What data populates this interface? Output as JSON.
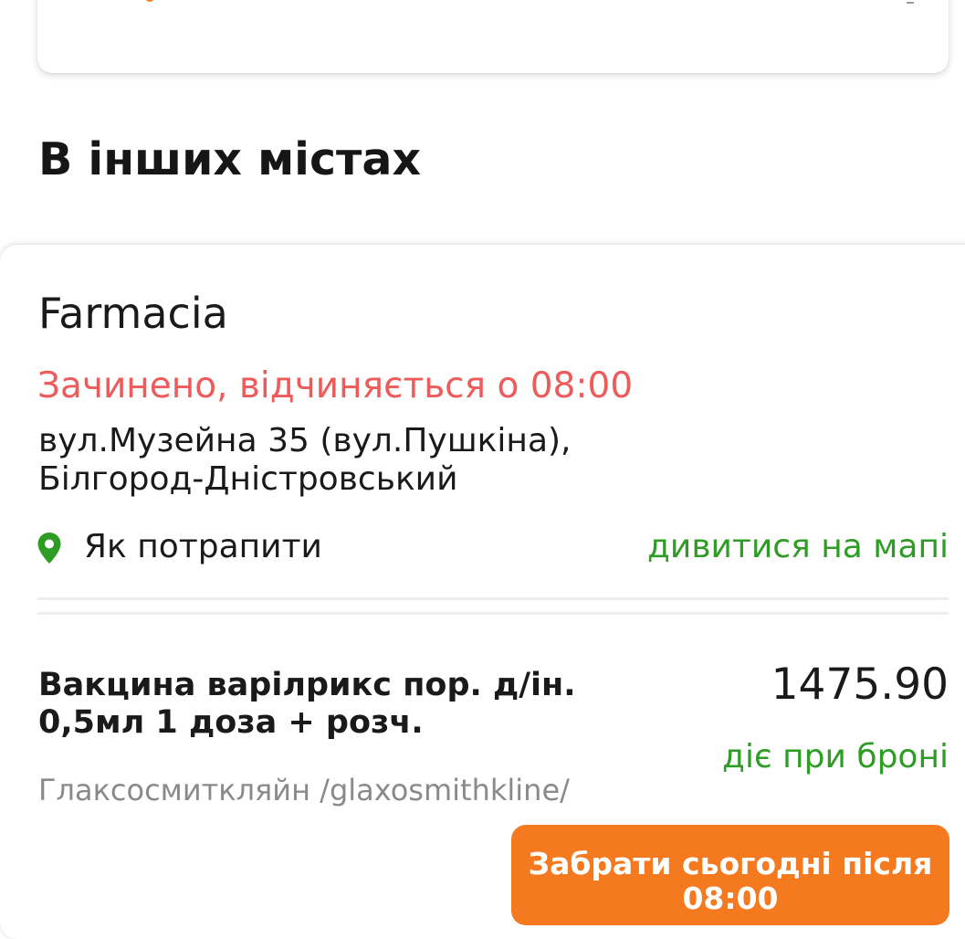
{
  "section": {
    "title": "В інших містах"
  },
  "pharmacy": {
    "name": "Farmacia",
    "status": "Зачинено, відчиняється о 08:00",
    "address_line1": "вул.Музейна 35 (вул.Пушкіна),",
    "address_line2": "Білгород-Дністровський",
    "directions_label": "Як потрапити",
    "map_link": "дивитися на мапі",
    "pin_icon": "map-pin-icon"
  },
  "product": {
    "name_line1": "Вакцина варілрикс пор. д/ін.",
    "name_line2": "0,5мл 1 доза + розч.",
    "price": "1475.90",
    "price_note": "діє при броні",
    "manufacturer": "Глаксосмиткляйн /glaxosmithkline/",
    "button_line1": "Забрати сьогодні після",
    "button_line2": "08:00"
  },
  "colors": {
    "accent_orange": "#f57a1f",
    "status_red": "#ef5a5a",
    "link_green": "#2f9d25",
    "muted_gray": "#8a8a8a"
  }
}
